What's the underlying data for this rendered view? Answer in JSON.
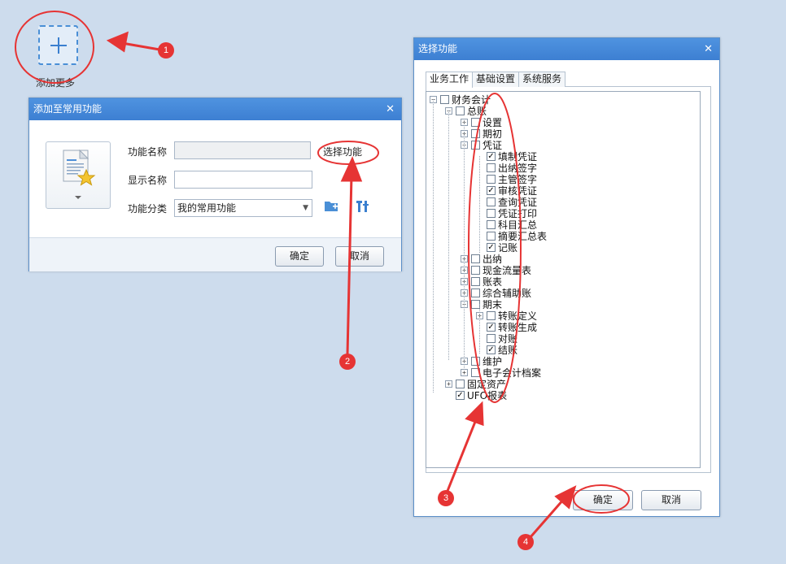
{
  "add_tile": {
    "label": "添加更多"
  },
  "add_dialog": {
    "title": "添加至常用功能",
    "function_name_label": "功能名称",
    "function_name_value": "",
    "display_name_label": "显示名称",
    "display_name_value": "",
    "category_label": "功能分类",
    "category_value": "我的常用功能",
    "select_function_link": "选择功能",
    "ok_label": "确定",
    "cancel_label": "取消"
  },
  "select_dialog": {
    "title": "选择功能",
    "tabs": [
      "业务工作",
      "基础设置",
      "系统服务"
    ],
    "ok_label": "确定",
    "cancel_label": "取消",
    "tree": [
      {
        "label": "财务会计",
        "level": 0,
        "expander": "minus",
        "checked": false
      },
      {
        "label": "总账",
        "level": 1,
        "expander": "minus",
        "checked": false
      },
      {
        "label": "设置",
        "level": 2,
        "expander": "plus",
        "checked": false
      },
      {
        "label": "期初",
        "level": 2,
        "expander": "plus",
        "checked": false
      },
      {
        "label": "凭证",
        "level": 2,
        "expander": "minus",
        "checked": false
      },
      {
        "label": "填制凭证",
        "level": 3,
        "expander": "none",
        "checked": true
      },
      {
        "label": "出纳签字",
        "level": 3,
        "expander": "none",
        "checked": false
      },
      {
        "label": "主管签字",
        "level": 3,
        "expander": "none",
        "checked": false
      },
      {
        "label": "审核凭证",
        "level": 3,
        "expander": "none",
        "checked": true
      },
      {
        "label": "查询凭证",
        "level": 3,
        "expander": "none",
        "checked": false
      },
      {
        "label": "凭证打印",
        "level": 3,
        "expander": "none",
        "checked": false
      },
      {
        "label": "科目汇总",
        "level": 3,
        "expander": "none",
        "checked": false
      },
      {
        "label": "摘要汇总表",
        "level": 3,
        "expander": "none",
        "checked": false
      },
      {
        "label": "记账",
        "level": 3,
        "expander": "none",
        "checked": true
      },
      {
        "label": "出纳",
        "level": 2,
        "expander": "plus",
        "checked": false
      },
      {
        "label": "现金流量表",
        "level": 2,
        "expander": "plus",
        "checked": false
      },
      {
        "label": "账表",
        "level": 2,
        "expander": "plus",
        "checked": false
      },
      {
        "label": "综合辅助账",
        "level": 2,
        "expander": "plus",
        "checked": false
      },
      {
        "label": "期末",
        "level": 2,
        "expander": "minus",
        "checked": false
      },
      {
        "label": "转账定义",
        "level": 3,
        "expander": "plus",
        "checked": false
      },
      {
        "label": "转账生成",
        "level": 3,
        "expander": "none",
        "checked": true
      },
      {
        "label": "对账",
        "level": 3,
        "expander": "none",
        "checked": false
      },
      {
        "label": "结账",
        "level": 3,
        "expander": "none",
        "checked": true
      },
      {
        "label": "维护",
        "level": 2,
        "expander": "plus",
        "checked": false
      },
      {
        "label": "电子会计档案",
        "level": 2,
        "expander": "plus",
        "checked": false
      },
      {
        "label": "固定资产",
        "level": 1,
        "expander": "plus",
        "checked": false
      },
      {
        "label": "UFO报表",
        "level": 1,
        "expander": "none",
        "checked": true
      }
    ]
  },
  "annotations": {
    "badges": [
      "1",
      "2",
      "3",
      "4"
    ],
    "color": "#e63434"
  }
}
